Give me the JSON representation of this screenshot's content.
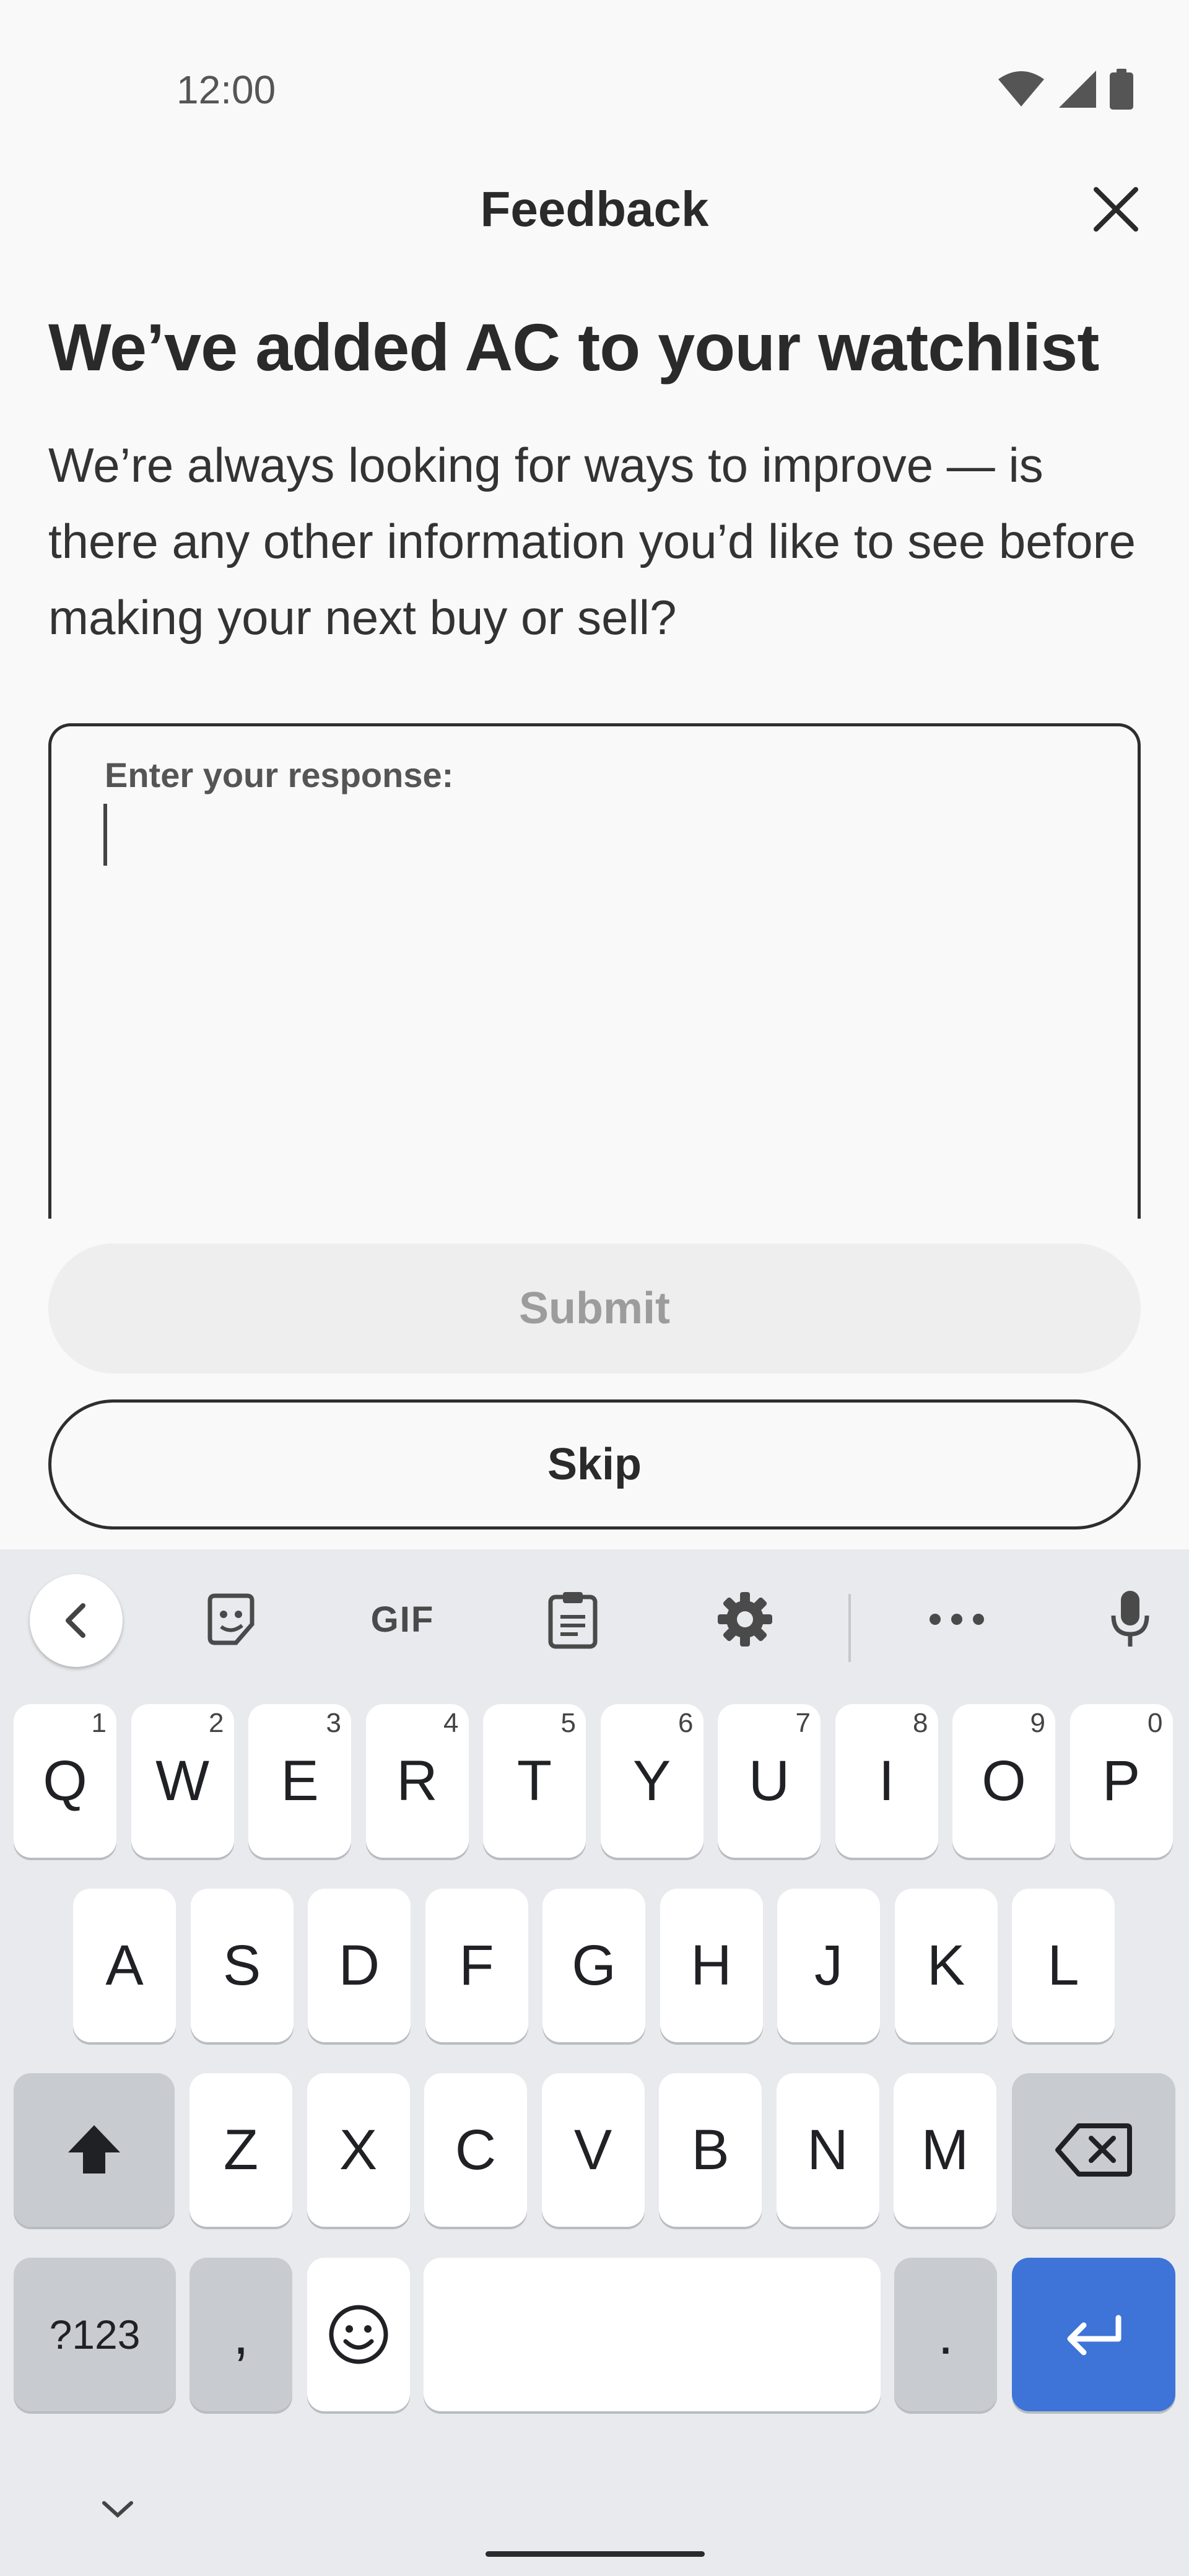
{
  "status_bar": {
    "time": "12:00",
    "icons": [
      "wifi-icon",
      "signal-icon",
      "battery-icon"
    ]
  },
  "header": {
    "title": "Feedback",
    "close_icon": "close-icon"
  },
  "main": {
    "headline": "We’ve added AC to your watchlist",
    "description": "We’re always looking for ways to improve — is there any other information you’d like to see before making your next buy or sell?",
    "response": {
      "label": "Enter your response:",
      "value": "",
      "placeholder": ""
    },
    "submit_label": "Submit",
    "skip_label": "Skip"
  },
  "keyboard": {
    "toolbar": {
      "items": [
        "chevron-left-icon",
        "sticker-icon",
        "GIF",
        "clipboard-icon",
        "gear-icon",
        "more-icon",
        "microphone-icon"
      ],
      "gif_label": "GIF"
    },
    "row1": [
      {
        "label": "Q",
        "hint": "1"
      },
      {
        "label": "W",
        "hint": "2"
      },
      {
        "label": "E",
        "hint": "3"
      },
      {
        "label": "R",
        "hint": "4"
      },
      {
        "label": "T",
        "hint": "5"
      },
      {
        "label": "Y",
        "hint": "6"
      },
      {
        "label": "U",
        "hint": "7"
      },
      {
        "label": "I",
        "hint": "8"
      },
      {
        "label": "O",
        "hint": "9"
      },
      {
        "label": "P",
        "hint": "0"
      }
    ],
    "row2": [
      "A",
      "S",
      "D",
      "F",
      "G",
      "H",
      "J",
      "K",
      "L"
    ],
    "row3": [
      "Z",
      "X",
      "C",
      "V",
      "B",
      "N",
      "M"
    ],
    "row4": {
      "symbols_label": "?123",
      "comma_label": ",",
      "period_label": "."
    },
    "colors": {
      "background": "#e8eaed",
      "key": "#ffffff",
      "modifier_key": "#c8cbd0",
      "enter_key": "#3e73d8"
    }
  }
}
